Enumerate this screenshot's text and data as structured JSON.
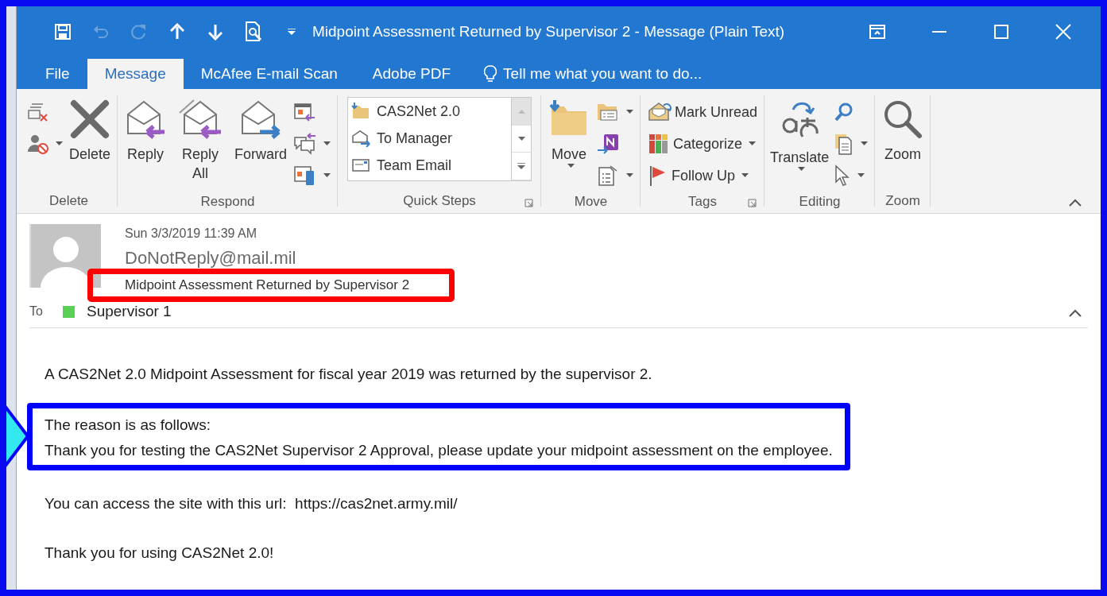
{
  "window": {
    "title": "Midpoint Assessment Returned by Supervisor 2 - Message (Plain Text)"
  },
  "quick_access": [
    {
      "kind": "save",
      "disabled": false
    },
    {
      "kind": "undo",
      "disabled": true
    },
    {
      "kind": "redo",
      "disabled": true
    },
    {
      "kind": "up",
      "disabled": false
    },
    {
      "kind": "down",
      "disabled": false
    },
    {
      "kind": "preview",
      "disabled": false
    },
    {
      "kind": "customize",
      "disabled": false
    }
  ],
  "tabs": [
    {
      "label": "File",
      "kind": "tab",
      "selected": false
    },
    {
      "label": "Message",
      "kind": "tab",
      "selected": true
    },
    {
      "label": "McAfee E-mail Scan",
      "kind": "tab",
      "selected": false
    },
    {
      "label": "Adobe PDF",
      "kind": "tab",
      "selected": false
    }
  ],
  "tell_me": {
    "placeholder": "Tell me what you want to do..."
  },
  "ribbon": {
    "groups": [
      {
        "label": "Delete",
        "launcher": false,
        "controls": [
          {
            "kind": "column",
            "items": [
              {
                "dropdown": false
              },
              {
                "dropdown": true
              }
            ]
          },
          {
            "kind": "large",
            "label": "Delete",
            "dropdown": false
          }
        ]
      },
      {
        "label": "Respond",
        "launcher": false,
        "controls": [
          {
            "kind": "large",
            "label": "Reply",
            "dropdown": false
          },
          {
            "kind": "large",
            "label": "Reply All",
            "dropdown": false
          },
          {
            "kind": "large",
            "label": "Forward",
            "dropdown": false
          },
          {
            "kind": "column",
            "items": [
              {
                "dropdown": false
              },
              {
                "dropdown": true
              },
              {
                "dropdown": true
              }
            ]
          }
        ]
      },
      {
        "label": "Quick Steps",
        "launcher": true,
        "controls": [
          {
            "kind": "gallery",
            "items": [
              "CAS2Net 2.0",
              "To Manager",
              "Team Email"
            ]
          }
        ]
      },
      {
        "label": "Move",
        "launcher": false,
        "controls": [
          {
            "kind": "large",
            "label": "Move",
            "dropdown": true
          },
          {
            "kind": "column",
            "items": [
              {
                "dropdown": true
              },
              {
                "dropdown": false
              },
              {
                "dropdown": true
              }
            ]
          }
        ]
      },
      {
        "label": "Tags",
        "launcher": true,
        "controls": [
          {
            "kind": "column",
            "items": [
              {
                "label": "Mark Unread",
                "dropdown": false
              },
              {
                "label": "Categorize",
                "dropdown": true
              },
              {
                "label": "Follow Up",
                "dropdown": true
              }
            ]
          }
        ]
      },
      {
        "label": "Editing",
        "launcher": false,
        "controls": [
          {
            "kind": "large",
            "label": "Translate",
            "dropdown": true
          },
          {
            "kind": "column",
            "items": [
              {
                "dropdown": false
              },
              {
                "dropdown": true
              },
              {
                "dropdown": true
              }
            ]
          }
        ]
      },
      {
        "label": "Zoom",
        "launcher": false,
        "controls": [
          {
            "kind": "large",
            "label": "Zoom",
            "dropdown": false
          }
        ]
      }
    ]
  },
  "message": {
    "date": "Sun 3/3/2019 11:39 AM",
    "sender": "DoNotReply@mail.mil",
    "subject": {
      "text": "Midpoint Assessment Returned by Supervisor 2",
      "highlight": {
        "color": "#ff0000"
      }
    },
    "to_label": "To",
    "recipients": [
      {
        "name": "Supervisor 1",
        "color": "#5ccf57"
      }
    ]
  },
  "body": {
    "paragraphs": [
      {
        "lines": [
          "A CAS2Net 2.0 Midpoint Assessment for fiscal year 2019 was returned by the supervisor 2."
        ]
      },
      {
        "lines": [
          "The reason is as follows:",
          "Thank you for testing the CAS2Net Supervisor 2 Approval, please update your midpoint assessment on the employee."
        ],
        "highlight": {
          "color": "#0000ff"
        }
      },
      {
        "lines": [
          "You can access the site with this url:  https://cas2net.army.mil/"
        ]
      },
      {
        "lines": [
          "Thank you for using CAS2Net 2.0!"
        ]
      }
    ]
  }
}
